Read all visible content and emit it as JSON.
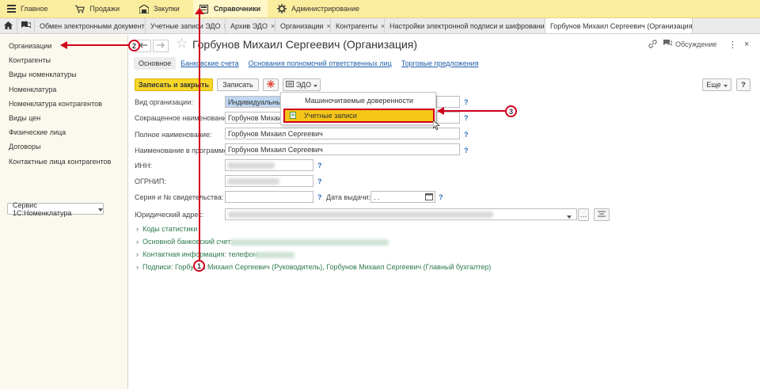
{
  "topmenu": [
    {
      "label": "Главное",
      "icon": "hamburger-icon"
    },
    {
      "label": "Продажи",
      "icon": "cart-icon"
    },
    {
      "label": "Закупки",
      "icon": "warehouse-icon"
    },
    {
      "label": "Справочники",
      "icon": "book-icon"
    },
    {
      "label": "Администрирование",
      "icon": "gear-icon"
    }
  ],
  "tabs": [
    {
      "label": "Обмен электронными документами"
    },
    {
      "label": "Учетные записи ЭДО"
    },
    {
      "label": "Архив ЭДО"
    },
    {
      "label": "Организации"
    },
    {
      "label": "Контрагенты"
    },
    {
      "label": "Настройки электронной подписи и шифрования"
    },
    {
      "label": "Горбунов Михаил Сергеевич (Организация)"
    }
  ],
  "close_glyph": "×",
  "sidebar": {
    "items": [
      "Организации",
      "Контрагенты",
      "Виды номенклатуры",
      "Номенклатура",
      "Номенклатура контрагентов",
      "Виды цен",
      "Физические лица",
      "Договоры",
      "Контактные лица контрагентов"
    ],
    "service_button": "Сервис 1С:Номенклатура"
  },
  "form": {
    "title": "Горбунов Михаил Сергеевич (Организация)",
    "discussion": "Обсуждение",
    "more_glyph": "⋮",
    "close_glyph": "×",
    "subtabs": [
      "Основное",
      "Банковские счета",
      "Основания полномочий ответственных лиц",
      "Торговые предложения"
    ],
    "buttons": {
      "save_close": "Записать и закрыть",
      "save": "Записать",
      "edo": "ЭДО",
      "more": "Еще",
      "help": "?"
    },
    "labels": {
      "org_type": "Вид организации:",
      "short_name": "Сокращенное наименование:",
      "full_name": "Полное наименование:",
      "program_name": "Наименование в программе:",
      "inn": "ИНН:",
      "ogrnip": "ОГРНИП:",
      "certificate": "Серия и № свидетельства:",
      "issue_date": "Дата выдачи:",
      "address": "Юридический адрес:"
    },
    "values": {
      "org_type": "Индивидуальный",
      "short_name": "Горбунов Михаил С",
      "full_name": "Горбунов Михаил Сергеевич",
      "program_name": "Горбунов Михаил Сергеевич",
      "issue_date": ". .",
      "q": "?"
    },
    "sections": {
      "stats_codes": "Коды статистики",
      "bank_account": "Основной банковский счет:",
      "contact_info": "Контактная информация: телефон:",
      "signatures": "Подписи: Горбунов Михаил Сергеевич (Руководитель), Горбунов Михаил Сергеевич (Главный бухгалтер)"
    }
  },
  "dropdown": {
    "items": [
      "Машиночитаемые доверенности",
      "Учетные записи"
    ]
  },
  "callouts": [
    "1",
    "2",
    "3"
  ],
  "colors": {
    "accent": "#f8d72b",
    "annotation": "#d0021b",
    "link": "#1f5fa9",
    "section": "#2d7a4b"
  }
}
